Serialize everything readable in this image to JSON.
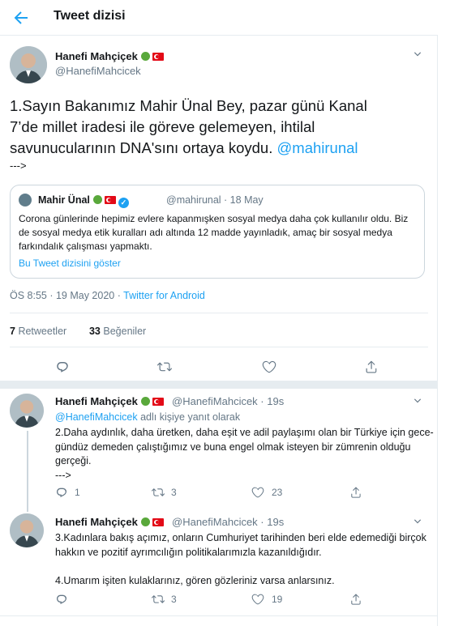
{
  "header": {
    "title": "Tweet dizisi"
  },
  "main_tweet": {
    "name": "Hanefi Mahçiçek",
    "handle": "@HanefiMahcicek",
    "text_lines": [
      "1.Sayın Bakanımız Mahir Ünal Bey, pazar günü Kanal",
      "7’de millet iradesi ile göreve gelemeyen, ihtilal",
      "savunucularının DNA'sını ortaya koydu. ",
      "--->"
    ],
    "mention": "@mahirunal",
    "quote": {
      "name": "Mahir Ünal",
      "handle": "@mahirunal · 18 May",
      "text": "Corona günlerinde hepimiz evlere kapanmışken sosyal medya daha çok kullanılır oldu. Biz de sosyal medya etik kuralları adı altında 12 madde yayınladık, amaç bir sosyal medya farkındalık çalışması yapmaktı.",
      "link": "Bu Tweet dizisini göster"
    },
    "time": "ÖS 8:55 · 19 May 2020 · ",
    "source": "Twitter for Android",
    "retweets_count": "7",
    "retweets_label": "Retweetler",
    "likes_count": "33",
    "likes_label": "Beğeniler"
  },
  "replies": [
    {
      "name": "Hanefi Mahçiçek",
      "handle": "@HanefiMahcicek · 19s",
      "reply_prefix": "",
      "reply_handle": "@HanefiMahcicek",
      "reply_suffix": " adlı kişiye yanıt olarak",
      "text": "2.Daha aydınlık, daha üretken, daha eşit ve adil paylaşımı olan bir Türkiye için gece-gündüz demeden çalıştığımız ve buna engel olmak isteyen bir zümrenin olduğu gerçeği.\n--->",
      "reply_count": "1",
      "retweet_count": "3",
      "like_count": "23"
    },
    {
      "name": "Hanefi Mahçiçek",
      "handle": "@HanefiMahcicek · 19s",
      "text": "3.Kadınlara bakış açımız, onların Cumhuriyet tarihinden beri elde edemediği birçok hakkın ve pozitif ayrımcılığın politikalarımızla kazanıldığıdır.\n\n4.Umarım işiten kulaklarınız, gören gözleriniz varsa anlarsınız.",
      "reply_count": "",
      "retweet_count": "3",
      "like_count": "19"
    }
  ],
  "icons": {
    "back": "arrow-left-icon",
    "reply": "reply-icon",
    "retweet": "retweet-icon",
    "like": "heart-icon",
    "share": "share-icon"
  },
  "colors": {
    "accent": "#1da1f2",
    "muted": "#657786",
    "border": "#e6ecf0"
  }
}
